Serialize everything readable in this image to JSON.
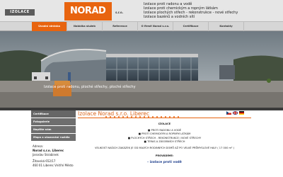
{
  "header": {
    "brand": "IZOLACE",
    "logo": "NORAD",
    "sro": "s.r.o.",
    "tagline": [
      "Izolace proti radonu a vodě",
      "Izolace proti chemickým a ropným látkám",
      "Izolace plochých střech - rekonstrukce - nové střechy",
      "Izolace bazénů a vodních sítí"
    ],
    "colors": {
      "orange": "#e8640f",
      "grey": "#e6e6e6"
    }
  },
  "nav": {
    "items": [
      {
        "label": "Úvodní stránka",
        "active": true
      },
      {
        "label": "Nabídka služeb",
        "active": false
      },
      {
        "label": "Reference",
        "active": false
      },
      {
        "label": "O firmě Norad s.r.o.",
        "active": false
      },
      {
        "label": "Certifikace",
        "active": false
      },
      {
        "label": "Kontakty",
        "active": false
      }
    ]
  },
  "hero": {
    "caption": "Izolace proti radonu, ploché střechy, ploché střechy"
  },
  "sidebar": {
    "items": [
      {
        "label": "Certifikace"
      },
      {
        "label": "Fotogalerie"
      },
      {
        "label": "Napište nám"
      },
      {
        "label": "Mapa a ukazování ruzidla"
      }
    ],
    "contact": {
      "heading": "Adresa:",
      "company": "Norad s.r.o. Liberec",
      "person": "Jaroslav Skrabinek",
      "street": "Žitavská 652/17",
      "city": "460 01 Liberec Vnitřní Město"
    }
  },
  "main": {
    "title": "Izolace Norad s.r.o. Liberec",
    "section": "IZOLACE",
    "bullets": [
      "■ PROTI RADONU A VODĚ",
      "■ PROTI CHEMICKÝM A ROPNÝM LÁTKÁM",
      "■ PLOCHÝCH STŘECH - REKONSTRUKCE / NOVÉ STŘECHY",
      "■ TERAS A ZÁSOBNÍCH STŘECH"
    ],
    "note": "VELIKOST NAŠICH ZAKÁZEK JE OD MALÝCH RODINNÝCH DOMŮ AŽ PO VELKÉ PRŮMYSLOVÉ HALY ( 17 000 m² )",
    "offer_heading": "PROVÁDÍME:",
    "offer_item": "- izolace proti vodě",
    "flags": [
      "cz",
      "gb",
      "de"
    ]
  }
}
